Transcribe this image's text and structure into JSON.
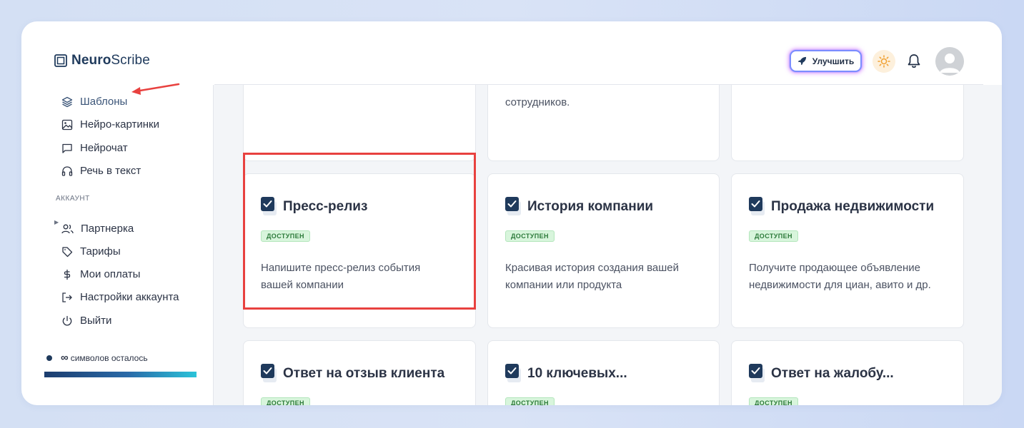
{
  "header": {
    "logo_bold": "Neuro",
    "logo_light": "Scribe",
    "upgrade_label": "Улучшить"
  },
  "sidebar": {
    "items": [
      {
        "label": "Шаблоны",
        "icon": "layers-icon",
        "active": true
      },
      {
        "label": "Нейро-картинки",
        "icon": "image-icon"
      },
      {
        "label": "Нейрочат",
        "icon": "chat-icon"
      },
      {
        "label": "Речь в текст",
        "icon": "headphones-icon"
      }
    ],
    "section_account": "АККАУНТ",
    "account_items": [
      {
        "label": "Партнерка",
        "icon": "users-icon"
      },
      {
        "label": "Тарифы",
        "icon": "tag-icon"
      },
      {
        "label": "Мои оплаты",
        "icon": "dollar-icon"
      },
      {
        "label": "Настройки аккаунта",
        "icon": "login-icon"
      },
      {
        "label": "Выйти",
        "icon": "power-icon"
      }
    ],
    "symbols_value": "∞",
    "symbols_label": "символов осталось"
  },
  "cards_top": [
    {
      "desc": ""
    },
    {
      "desc": "сотрудников."
    },
    {
      "desc": ""
    }
  ],
  "cards": [
    {
      "title": "Пресс-релиз",
      "badge": "ДОСТУПЕН",
      "desc": "Напишите пресс-релиз события вашей компании"
    },
    {
      "title": "История компании",
      "badge": "ДОСТУПЕН",
      "desc": "Красивая история создания вашей компании или продукта"
    },
    {
      "title": "Продажа недвижимости",
      "badge": "ДОСТУПЕН",
      "desc": "Получите продающее объявление недвижимости для циан, авито и др."
    },
    {
      "title": "Ответ на отзыв клиента",
      "badge": "ДОСТУПЕН",
      "desc": ""
    },
    {
      "title": "10 ключевых...",
      "badge": "ДОСТУПЕН",
      "desc": ""
    },
    {
      "title": "Ответ на жалобу...",
      "badge": "ДОСТУПЕН",
      "desc": ""
    }
  ],
  "colors": {
    "accent": "#1f3a5c",
    "highlight_border": "#e8413f",
    "badge_bg": "#d8f5dc",
    "badge_text": "#2c7a3a"
  }
}
